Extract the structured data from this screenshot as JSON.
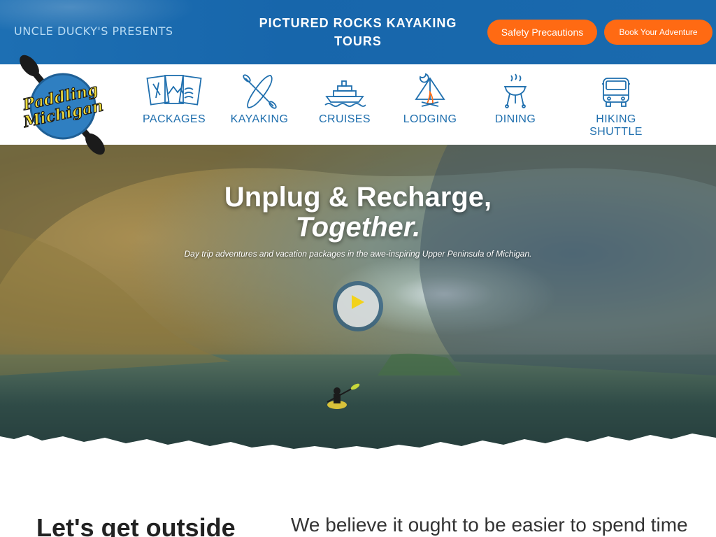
{
  "header": {
    "presents": "UNCLE DUCKY'S PRESENTS",
    "title": "PICTURED ROCKS KAYAKING TOURS",
    "buttons": {
      "safety": "Safety Precautions",
      "book": "Book Your Adventure"
    },
    "accent_color": "#ff6a13",
    "bar_color": "#1a6aae"
  },
  "logo": {
    "line1": "Paddling",
    "line2": "Michigan"
  },
  "nav": [
    {
      "label": "PACKAGES",
      "icon": "brochures-icon"
    },
    {
      "label": "KAYAKING",
      "icon": "kayak-paddle-icon"
    },
    {
      "label": "CRUISES",
      "icon": "cruise-ship-icon"
    },
    {
      "label": "LODGING",
      "icon": "campfire-tent-icon"
    },
    {
      "label": "DINING",
      "icon": "grill-icon"
    },
    {
      "label": "HIKING SHUTTLE",
      "icon": "shuttle-van-icon"
    }
  ],
  "hero": {
    "title_line1": "Unplug & Recharge,",
    "title_line2": "Together.",
    "subtitle": "Day trip adventures and vacation packages in the awe-inspiring Upper Peninsula of Michigan."
  },
  "intro": {
    "heading": "Let's get outside",
    "text": "We believe it ought to be easier to spend time"
  }
}
